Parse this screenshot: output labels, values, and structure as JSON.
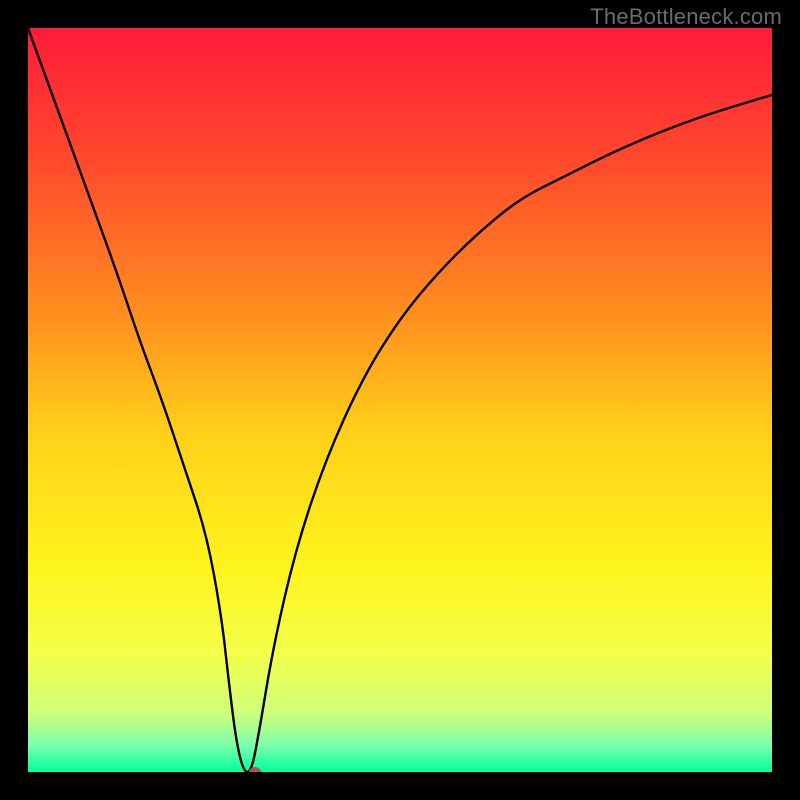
{
  "watermark": "TheBottleneck.com",
  "chart_data": {
    "type": "line",
    "title": "",
    "xlabel": "",
    "ylabel": "",
    "xlim": [
      0,
      100
    ],
    "ylim": [
      0,
      100
    ],
    "grid": false,
    "legend": null,
    "annotations": [],
    "background_gradient": [
      {
        "pos": 0.0,
        "color": "#ff1b3b"
      },
      {
        "pos": 0.18,
        "color": "#ff4a2c"
      },
      {
        "pos": 0.38,
        "color": "#ff8d1f"
      },
      {
        "pos": 0.55,
        "color": "#ffd21a"
      },
      {
        "pos": 0.72,
        "color": "#fff31c"
      },
      {
        "pos": 0.84,
        "color": "#f4ff4a"
      },
      {
        "pos": 0.92,
        "color": "#cfff7a"
      },
      {
        "pos": 0.965,
        "color": "#7affad"
      },
      {
        "pos": 1.0,
        "color": "#00ff9c"
      }
    ],
    "series": [
      {
        "name": "bottleneck-curve",
        "color": "#000000",
        "x": [
          0,
          4,
          8,
          12,
          15,
          18,
          21,
          24,
          26,
          27,
          28,
          29,
          30,
          31,
          33,
          36,
          40,
          45,
          50,
          55,
          60,
          66,
          72,
          80,
          90,
          100
        ],
        "y": [
          100,
          89,
          78,
          67,
          58,
          50,
          41,
          32,
          21,
          12,
          4,
          0,
          0,
          5,
          17,
          30,
          42,
          53,
          61,
          67,
          72,
          77,
          80,
          84,
          88,
          91
        ]
      }
    ],
    "marker": {
      "x": 30.5,
      "y": 0,
      "color": "#c24a4a",
      "rx": 6,
      "ry": 5
    }
  }
}
